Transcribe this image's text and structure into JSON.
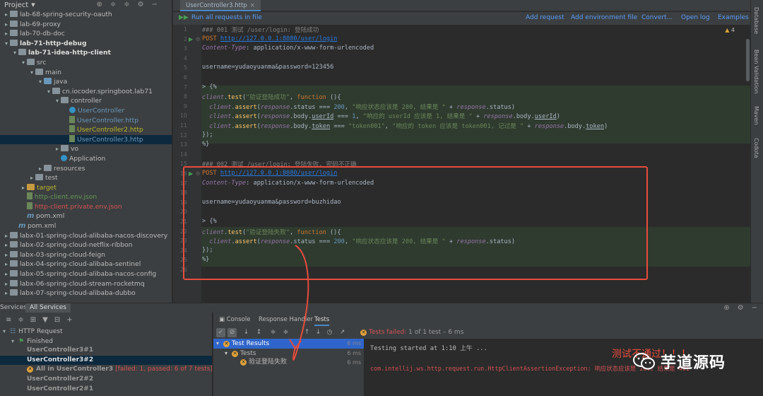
{
  "project_panel": {
    "title": "Project",
    "tree": [
      {
        "label": "lab-68-spring-security-oauth",
        "depth": 0,
        "kind": "folder",
        "color": ""
      },
      {
        "label": "lab-69-proxy",
        "depth": 0,
        "kind": "folder",
        "color": ""
      },
      {
        "label": "lab-70-db-doc",
        "depth": 0,
        "kind": "folder",
        "color": ""
      },
      {
        "label": "lab-71-http-debug",
        "depth": 0,
        "kind": "folder",
        "color": "bold",
        "open": true
      },
      {
        "label": "lab-71-idea-http-client",
        "depth": 1,
        "kind": "folder",
        "color": "bold",
        "open": true
      },
      {
        "label": "src",
        "depth": 2,
        "kind": "folder",
        "color": "",
        "open": true
      },
      {
        "label": "main",
        "depth": 3,
        "kind": "folder",
        "color": "",
        "open": true
      },
      {
        "label": "java",
        "depth": 4,
        "kind": "folderb",
        "color": "",
        "open": true
      },
      {
        "label": "cn.iocoder.springboot.lab71",
        "depth": 5,
        "kind": "folder",
        "color": "",
        "open": true
      },
      {
        "label": "controller",
        "depth": 6,
        "kind": "folder",
        "color": "",
        "open": true
      },
      {
        "label": "UserController",
        "depth": 7,
        "kind": "class",
        "color": "blue"
      },
      {
        "label": "UserController.http",
        "depth": 7,
        "kind": "file",
        "color": "blue"
      },
      {
        "label": "UserController2.http",
        "depth": 7,
        "kind": "file",
        "color": "yellow"
      },
      {
        "label": "UserController3.http",
        "depth": 7,
        "kind": "file",
        "color": "blue",
        "selected": true
      },
      {
        "label": "vo",
        "depth": 6,
        "kind": "folder",
        "color": ""
      },
      {
        "label": "Application",
        "depth": 6,
        "kind": "class",
        "color": ""
      },
      {
        "label": "resources",
        "depth": 4,
        "kind": "folder",
        "color": ""
      },
      {
        "label": "test",
        "depth": 3,
        "kind": "folder",
        "color": ""
      },
      {
        "label": "target",
        "depth": 2,
        "kind": "foldery",
        "color": "yellow"
      },
      {
        "label": "http-client.env.json",
        "depth": 2,
        "kind": "file",
        "color": "green"
      },
      {
        "label": "http-client.private.env.json",
        "depth": 2,
        "kind": "file",
        "color": "red"
      },
      {
        "label": "pom.xml",
        "depth": 2,
        "kind": "m",
        "color": ""
      },
      {
        "label": "pom.xml",
        "depth": 1,
        "kind": "m",
        "color": ""
      },
      {
        "label": "labx-01-spring-cloud-alibaba-nacos-discovery",
        "depth": 0,
        "kind": "folder",
        "color": ""
      },
      {
        "label": "labx-02-spring-cloud-netflix-ribbon",
        "depth": 0,
        "kind": "folder",
        "color": ""
      },
      {
        "label": "labx-03-spring-cloud-feign",
        "depth": 0,
        "kind": "folder",
        "color": ""
      },
      {
        "label": "labx-04-spring-cloud-alibaba-sentinel",
        "depth": 0,
        "kind": "folder",
        "color": ""
      },
      {
        "label": "labx-05-spring-cloud-alibaba-nacos-config",
        "depth": 0,
        "kind": "folder",
        "color": ""
      },
      {
        "label": "labx-06-spring-cloud-stream-rocketmq",
        "depth": 0,
        "kind": "folder",
        "color": ""
      },
      {
        "label": "labx-07-spring-cloud-alibaba-dubbo",
        "depth": 0,
        "kind": "folder",
        "color": ""
      }
    ]
  },
  "editor": {
    "tab_label": "UserController3.http",
    "run_all": "Run all requests in file",
    "toolbar_links": [
      "Add request",
      "Add environment file",
      "Convert...",
      "Open log",
      "Examples"
    ],
    "warning_count": "4",
    "lines": [
      {
        "n": "1",
        "html": "<span class='cmt'>### 001 测试 /user/login: 登陆成功</span>"
      },
      {
        "n": "2",
        "run": true,
        "html": "<span class='kw'>POST</span> <span class='url'>http://127.0.0.1:8080/user/login</span>"
      },
      {
        "n": "3",
        "html": "<span class='hdr'>Content-Type</span>: application/x-www-form-urlencoded"
      },
      {
        "n": "4",
        "html": ""
      },
      {
        "n": "5",
        "html": "username=yudaoyuanma&amp;password=123456"
      },
      {
        "n": "6",
        "html": ""
      },
      {
        "n": "7",
        "html": "&gt; {%"
      },
      {
        "n": "8",
        "html": "<span class='it'>client</span>.<span class='fn'>test</span>(<span class='str'>\"验证登陆成功\"</span>, <span class='kw'>function</span> (){"
      },
      {
        "n": "9",
        "html": "  <span class='it'>client</span>.<span class='fn'>assert</span>(<span class='it'>response</span>.status === <span class='num'>200</span>, <span class='str'>\"响应状态应该是 200, 结果是 \"</span> + <span class='it'>response</span>.status)"
      },
      {
        "n": "10",
        "html": "  <span class='it'>client</span>.<span class='fn'>assert</span>(<span class='it'>response</span>.body.<u>userId</u> === <span class='num'>1</span>, <span class='str'>\"响应的 userId 应该是 1, 结果是 \"</span> + <span class='it'>response</span>.body.<u>userId</u>)"
      },
      {
        "n": "11",
        "html": "  <span class='it'>client</span>.<span class='fn'>assert</span>(<span class='it'>response</span>.body.<u>token</u> === <span class='str'>\"token001\"</span>, <span class='str'>\"响应的 token 应该是 token001, 记过是 \"</span> + <span class='it'>response</span>.body.<u>token</u>)"
      },
      {
        "n": "12",
        "html": "});"
      },
      {
        "n": "13",
        "html": "%}"
      },
      {
        "n": "14",
        "html": ""
      },
      {
        "n": "15",
        "html": "<span class='cmt'>### 002 测试 /user/login: 登陆失败, 密码不正确</span>"
      },
      {
        "n": "16",
        "run": true,
        "html": "<span class='kw'>POST</span> <span class='url'>http://127.0.0.1:8080/user/login</span>"
      },
      {
        "n": "17",
        "html": "<span class='hdr'>Content-Type</span>: application/x-www-form-urlencoded"
      },
      {
        "n": "18",
        "html": ""
      },
      {
        "n": "19",
        "html": "username=yudaoyuanma&amp;password=buzhidao"
      },
      {
        "n": "20",
        "html": ""
      },
      {
        "n": "21",
        "html": "&gt; {%"
      },
      {
        "n": "22",
        "html": "<span class='it'>client</span>.<span class='fn'>test</span>(<span class='str'>\"验证登陆失败\"</span>, <span class='kw'>function</span> (){"
      },
      {
        "n": "23",
        "html": "  <span class='it'>client</span>.<span class='fn'>assert</span>(<span class='it'>response</span>.status === <span class='num'>200</span>, <span class='str'>\"响应状态应该是 200, 结果是 \"</span> + <span class='it'>response</span>.status)"
      },
      {
        "n": "24",
        "html": "});"
      },
      {
        "n": "25",
        "html": "%}"
      },
      {
        "n": "26",
        "html": ""
      }
    ]
  },
  "right_strip": [
    "Database",
    "Bean Validation",
    "Maven",
    "Codota"
  ],
  "services": {
    "label": "Services:",
    "tab": "All Services",
    "tree": [
      {
        "label": "HTTP Request",
        "depth": 0,
        "icon": "globe"
      },
      {
        "label": "Finished",
        "depth": 1,
        "icon": "finished"
      },
      {
        "label": "UserController3#1",
        "depth": 2,
        "icon": "",
        "bold": true
      },
      {
        "label": "UserController3#2",
        "depth": 2,
        "icon": "",
        "bold": true,
        "selected": true
      },
      {
        "label": "All in UserController3",
        "depth": 2,
        "icon": "fail",
        "suffix": "[failed: 1, passed: 6 of 7 tests]"
      },
      {
        "label": "UserController2#2",
        "depth": 2,
        "icon": "",
        "bold": true
      },
      {
        "label": "UserController2#1",
        "depth": 2,
        "icon": "",
        "bold": true
      }
    ],
    "sub_tabs": [
      "Console",
      "Response Handler",
      "Tests"
    ],
    "fail_summary": "Tests failed:",
    "fail_detail": "1 of 1 test – 6 ms",
    "test_tree": [
      {
        "label": "Test Results",
        "time": "6 ms",
        "depth": 0,
        "selected": true
      },
      {
        "label": "Tests",
        "time": "6 ms",
        "depth": 1
      },
      {
        "label": "验证登陆失败",
        "time": "6 ms",
        "depth": 2
      }
    ],
    "console_lines": [
      "Testing started at 1:10 上午 ...",
      "com.intellij.ws.http.request.run.HttpClientAssertionException: 响应状态应该是 200, 结果是 401"
    ]
  },
  "overlay": {
    "red_text": "测试不通过！！！",
    "watermark": "芋道源码"
  }
}
